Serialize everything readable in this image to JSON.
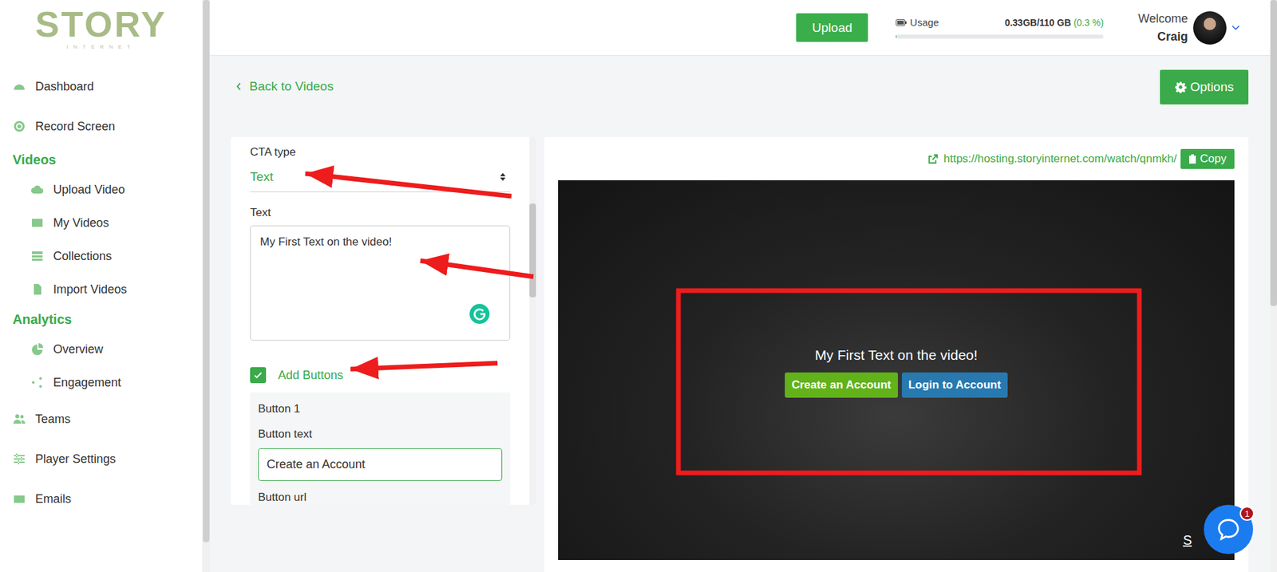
{
  "logo": {
    "title": "STORY",
    "subtitle": "INTERNET"
  },
  "sidebar": {
    "items": [
      {
        "label": "Dashboard",
        "kind": "item"
      },
      {
        "label": "Record Screen",
        "kind": "item"
      },
      {
        "label": "Videos",
        "kind": "header"
      },
      {
        "label": "Upload Video",
        "kind": "subitem"
      },
      {
        "label": "My Videos",
        "kind": "subitem"
      },
      {
        "label": "Collections",
        "kind": "subitem"
      },
      {
        "label": "Import Videos",
        "kind": "subitem"
      },
      {
        "label": "Analytics",
        "kind": "header"
      },
      {
        "label": "Overview",
        "kind": "subitem"
      },
      {
        "label": "Engagement",
        "kind": "subitem"
      },
      {
        "label": "Teams",
        "kind": "item"
      },
      {
        "label": "Player Settings",
        "kind": "item"
      },
      {
        "label": "Emails",
        "kind": "item"
      }
    ]
  },
  "topbar": {
    "upload_button": "Upload",
    "usage": {
      "label": "Usage",
      "reading": "0.33GB/110 GB",
      "percent": "(0.3 %)",
      "level": 0.003
    },
    "welcome": "Welcome",
    "user": "Craig"
  },
  "back_link": "Back to Videos",
  "options_button": "Options",
  "cta_form": {
    "cta_type_label": "CTA type",
    "cta_type_value": "Text",
    "text_label": "Text",
    "text_value": "My First Text on the video!",
    "add_buttons": {
      "label": "Add Buttons",
      "checked": true
    },
    "button_section": {
      "title": "Button 1",
      "button_text_label": "Button text",
      "button_text_value": "Create an Account",
      "button_url_label": "Button url"
    }
  },
  "preview": {
    "url": "https://hosting.storyinternet.com/watch/qnmkh/",
    "copy_button": "Copy",
    "overlay_text": "My First Text on the video!",
    "buttons": [
      {
        "label": "Create an Account",
        "color": "#62b21a"
      },
      {
        "label": "Login to Account",
        "color": "#2779b0"
      }
    ],
    "corner_text": "S"
  },
  "chat": {
    "badge": "1"
  }
}
